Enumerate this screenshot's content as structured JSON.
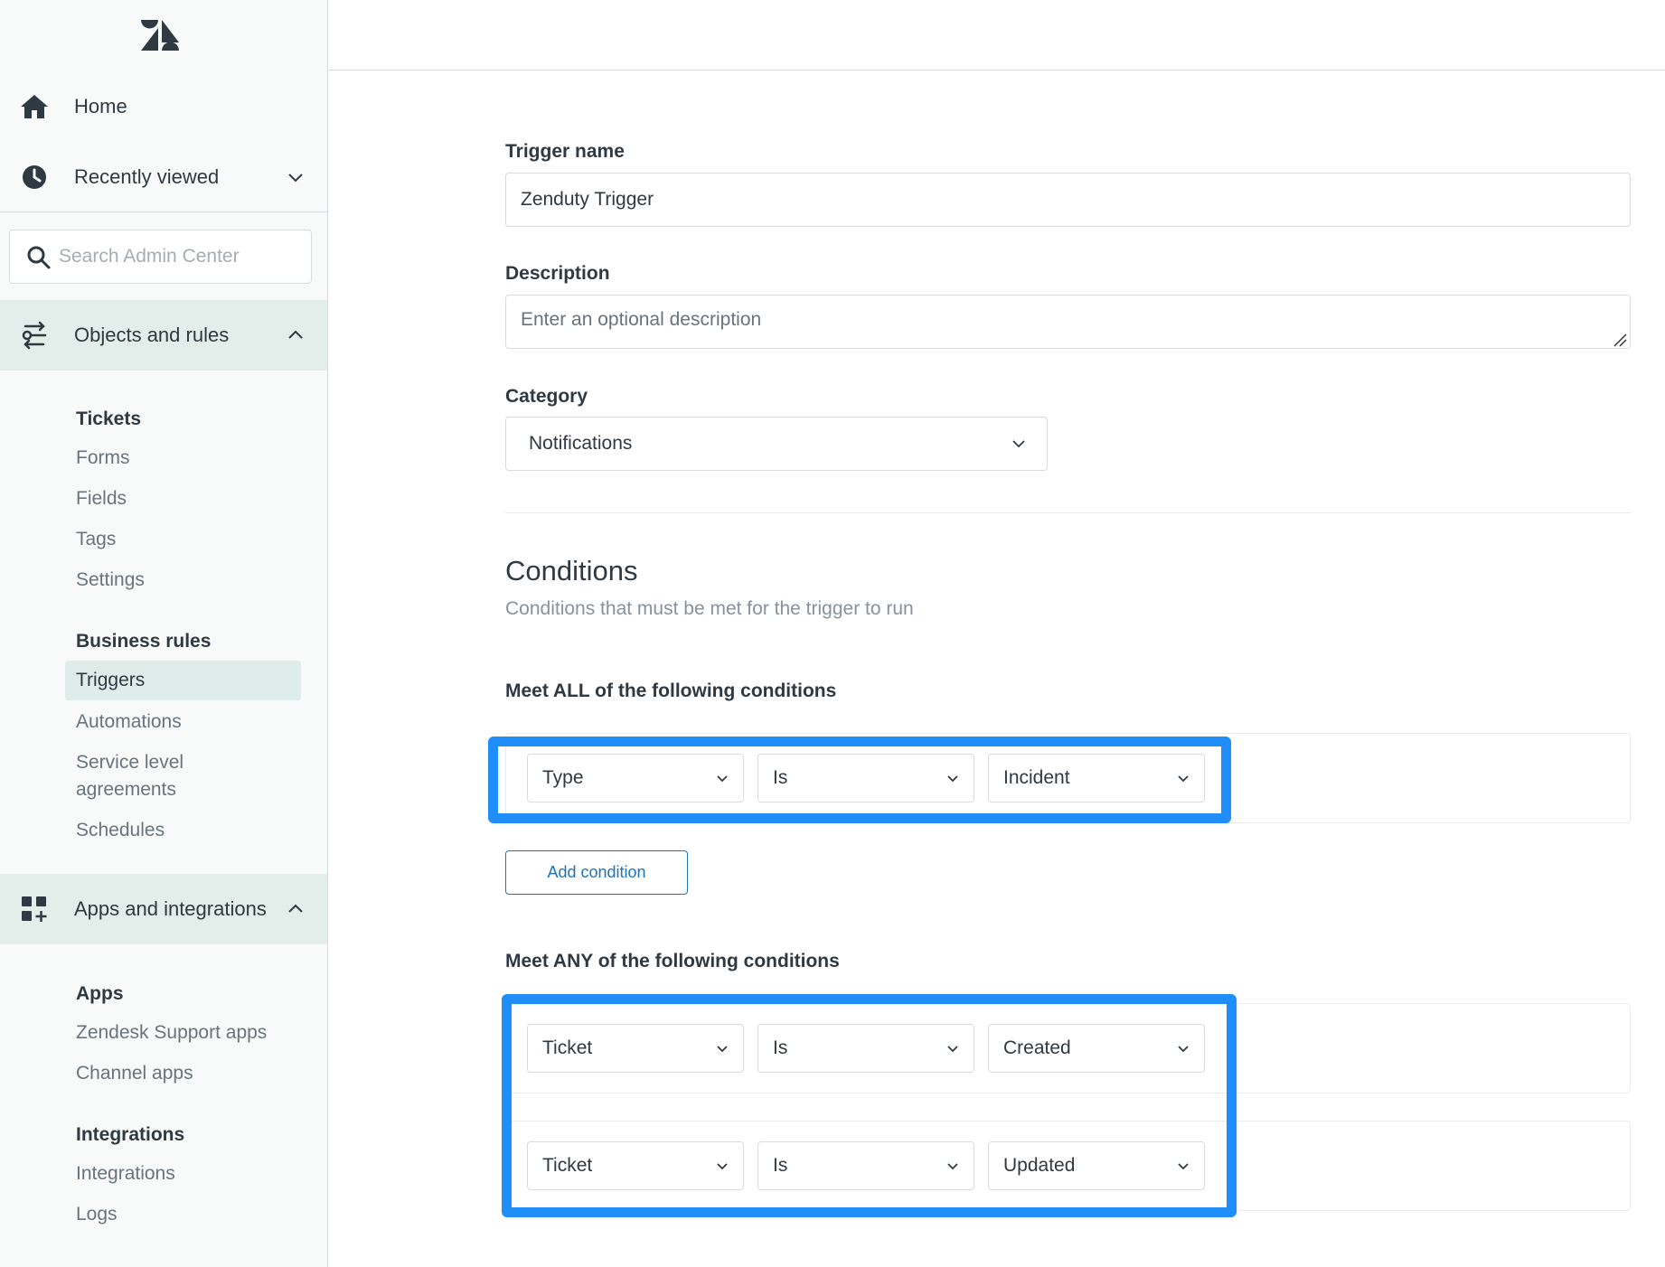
{
  "sidebar": {
    "logo_icon": "zendesk-logo",
    "home_label": "Home",
    "recent_label": "Recently viewed",
    "search_placeholder": "Search Admin Center",
    "objects_label": "Objects and rules",
    "objects_groups": [
      {
        "heading": "Tickets",
        "items": [
          "Forms",
          "Fields",
          "Tags",
          "Settings"
        ]
      },
      {
        "heading": "Business rules",
        "items": [
          "Triggers",
          "Automations",
          "Service level",
          "agreements",
          "Schedules"
        ]
      }
    ],
    "apps_label": "Apps and integrations",
    "apps_groups": [
      {
        "heading": "Apps",
        "items": [
          "Zendesk Support apps",
          "Channel apps"
        ]
      },
      {
        "heading": "Integrations",
        "items": [
          "Integrations",
          "Logs"
        ]
      }
    ],
    "selected_item": "Triggers"
  },
  "form": {
    "trigger_name_label": "Trigger name",
    "trigger_name_value": "Zenduty Trigger",
    "description_label": "Description",
    "description_placeholder": "Enter an optional description",
    "category_label": "Category",
    "category_value": "Notifications"
  },
  "conditions": {
    "title": "Conditions",
    "subtitle": "Conditions that must be met for the trigger to run",
    "all_label": "Meet ALL of the following conditions",
    "all": [
      {
        "field": "Type",
        "operator": "Is",
        "value": "Incident"
      }
    ],
    "add_label": "Add condition",
    "any_label": "Meet ANY of the following conditions",
    "any": [
      {
        "field": "Ticket",
        "operator": "Is",
        "value": "Created"
      },
      {
        "field": "Ticket",
        "operator": "Is",
        "value": "Updated"
      }
    ]
  },
  "colors": {
    "highlight": "#1f8ef9",
    "active_nav_bg": "#e3ede9",
    "link_blue": "#1f73b7"
  }
}
